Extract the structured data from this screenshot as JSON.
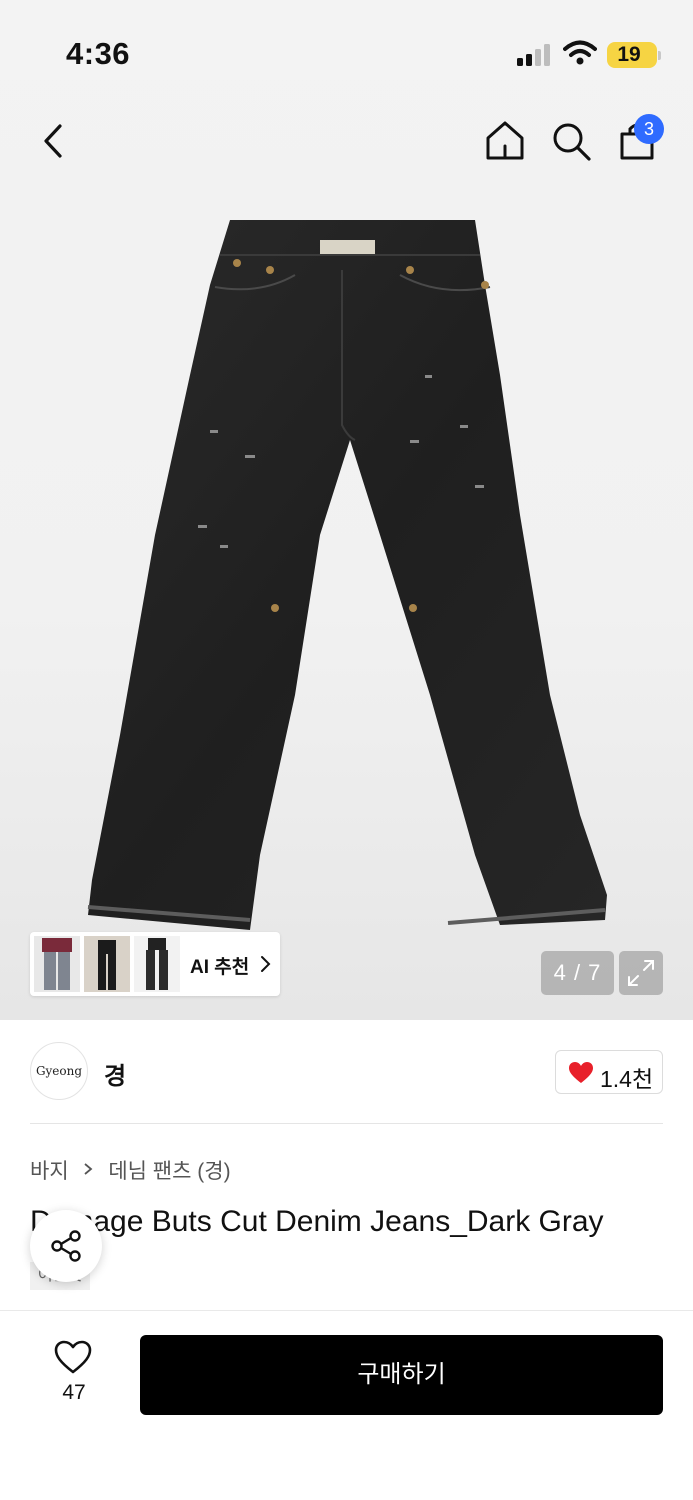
{
  "status_bar": {
    "time": "4:36",
    "battery": "19"
  },
  "nav": {
    "cart_count": "3"
  },
  "gallery": {
    "ai_recommend_label": "AI 추천",
    "page_counter": "4 / 7"
  },
  "brand": {
    "logo_text": "Gyeong",
    "name": "경",
    "like_count": "1.4천"
  },
  "breadcrumb": {
    "category": "바지",
    "subcategory": "데님 팬츠 (경)"
  },
  "product": {
    "title": "Damage Buts Cut Denim Jeans_Dark Gray",
    "tag": "어른것"
  },
  "bottom_bar": {
    "wish_count": "47",
    "buy_label": "구매하기"
  },
  "colors": {
    "accent_badge": "#2f6bff",
    "heart": "#e8202a",
    "battery": "#f6d443",
    "buy_button": "#000000"
  }
}
